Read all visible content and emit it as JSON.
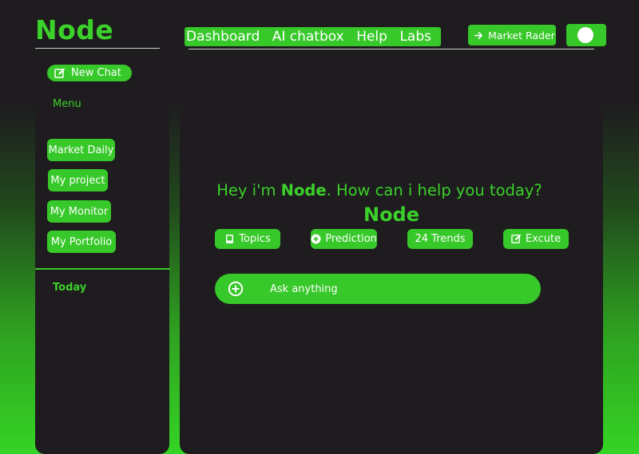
{
  "brand": {
    "name": "Node"
  },
  "topnav": {
    "items": [
      "Dashboard",
      "AI chatbox",
      "Help",
      "Labs"
    ],
    "market_button": "Market Rader",
    "theme_toggle": "on"
  },
  "sidebar": {
    "new_chat": "New Chat",
    "menu_label": "Menu",
    "items": [
      "Market Daily",
      "My project",
      "My Monitor",
      "My Portfolio"
    ],
    "section_today": "Today"
  },
  "main": {
    "logo": "Node",
    "greeting_prefix": "Hey i'm",
    "greeting_brand": "Node",
    "greeting_suffix": ". How can i help you today?",
    "chips": [
      {
        "label": "Topics",
        "icon": "book-icon"
      },
      {
        "label": "Prediction",
        "icon": "plus-circle-icon"
      },
      {
        "label": "24 Trends",
        "icon": ""
      },
      {
        "label": "Excute",
        "icon": "edit-icon"
      }
    ],
    "ask_placeholder": "Ask anything",
    "ask_icon": "plus-circle-icon"
  },
  "colors": {
    "accent": "#37c829",
    "text_accent": "#3bd12a",
    "panel": "#1e1c1f",
    "background": "#1e1c1f"
  }
}
